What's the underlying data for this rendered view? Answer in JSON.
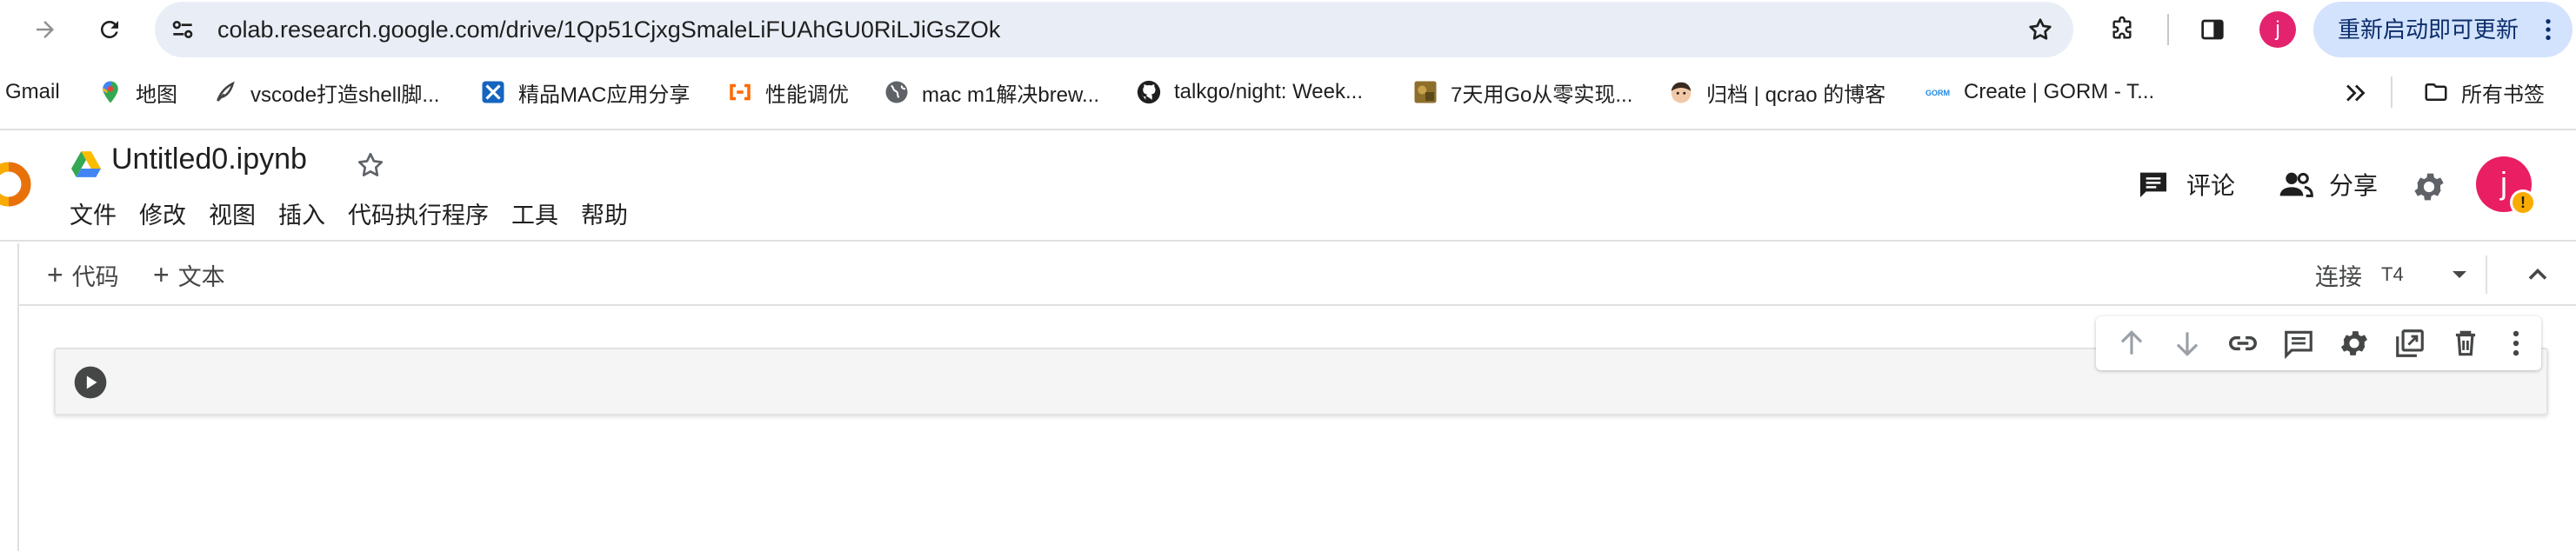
{
  "browser": {
    "url": "colab.research.google.com/drive/1Qp51CjxgSmaleLiFUAhGU0RiLJiGsZOk",
    "profile_initial": "j",
    "update_button_label": "重新启动即可更新"
  },
  "bookmarks": {
    "items": [
      {
        "label": "Gmail",
        "icon": "gmail-icon"
      },
      {
        "label": "地图",
        "icon": "maps-icon"
      },
      {
        "label": "vscode打造shell脚...",
        "icon": "site-icon"
      },
      {
        "label": "精品MAC应用分享",
        "icon": "site-icon"
      },
      {
        "label": "性能调优",
        "icon": "site-icon"
      },
      {
        "label": "mac m1解决brew...",
        "icon": "globe-icon"
      },
      {
        "label": "talkgo/night: Week...",
        "icon": "github-icon"
      },
      {
        "label": "7天用Go从零实现...",
        "icon": "site-icon"
      },
      {
        "label": "归档 | qcrao 的博客",
        "icon": "avatar-icon"
      },
      {
        "label": "Create | GORM - T...",
        "icon": "gorm-icon"
      }
    ],
    "overflow_icon": "chevron-double-right-icon",
    "all_bookmarks_label": "所有书签"
  },
  "colab": {
    "notebook_title": "Untitled0.ipynb",
    "menu": [
      "文件",
      "修改",
      "视图",
      "插入",
      "代码执行程序",
      "工具",
      "帮助"
    ],
    "comment_label": "评论",
    "share_label": "分享",
    "avatar_initial": "j",
    "avatar_badge": "!",
    "add_code_label": "代码",
    "add_text_label": "文本",
    "plus_glyph": "+",
    "connect_label": "连接",
    "runtime_label": "T4"
  },
  "colors": {
    "accent_blue": "#d3e3fd",
    "omnibox_bg": "#e9eef6",
    "avatar_pink": "#e91e63",
    "warning": "#f9ab00",
    "colab_orange": "#f9ab00"
  },
  "cell_actions": [
    "move-up-icon",
    "move-down-icon",
    "link-icon",
    "comment-icon",
    "settings-icon",
    "mirror-cell-icon",
    "delete-icon",
    "more-vert-icon"
  ]
}
